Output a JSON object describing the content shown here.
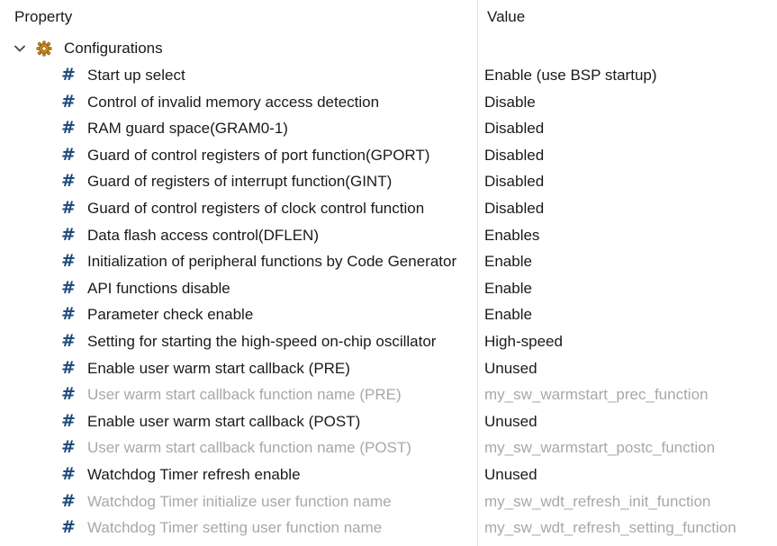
{
  "header": {
    "property_label": "Property",
    "value_label": "Value"
  },
  "group": {
    "label": "Configurations",
    "icon": "gear-icon",
    "expanded": true
  },
  "colors": {
    "hash_icon": "#1f4b7e",
    "disabled_text": "#a8a8a8"
  },
  "rows": [
    {
      "property": "Start up select",
      "value": "Enable (use BSP startup)",
      "enabled": true
    },
    {
      "property": "Control of invalid memory access detection",
      "value": "Disable",
      "enabled": true
    },
    {
      "property": "RAM guard space(GRAM0-1)",
      "value": "Disabled",
      "enabled": true
    },
    {
      "property": "Guard of control registers of port function(GPORT)",
      "value": "Disabled",
      "enabled": true
    },
    {
      "property": "Guard of registers of interrupt function(GINT)",
      "value": "Disabled",
      "enabled": true
    },
    {
      "property": "Guard of control registers of clock control function",
      "value": "Disabled",
      "enabled": true
    },
    {
      "property": "Data flash access control(DFLEN)",
      "value": "Enables",
      "enabled": true
    },
    {
      "property": "Initialization of peripheral functions by Code Generator",
      "value": "Enable",
      "enabled": true
    },
    {
      "property": "API functions disable",
      "value": "Enable",
      "enabled": true
    },
    {
      "property": "Parameter check enable",
      "value": "Enable",
      "enabled": true
    },
    {
      "property": "Setting for starting the high-speed on-chip oscillator",
      "value": "High-speed",
      "enabled": true
    },
    {
      "property": "Enable user warm start callback (PRE)",
      "value": "Unused",
      "enabled": true
    },
    {
      "property": "User warm start callback  function name (PRE)",
      "value": "my_sw_warmstart_prec_function",
      "enabled": false
    },
    {
      "property": "Enable user warm start callback (POST)",
      "value": "Unused",
      "enabled": true
    },
    {
      "property": "User warm start callback  function name (POST)",
      "value": "my_sw_warmstart_postc_function",
      "enabled": false
    },
    {
      "property": "Watchdog Timer refresh enable",
      "value": "Unused",
      "enabled": true
    },
    {
      "property": "Watchdog Timer initialize user function name",
      "value": "my_sw_wdt_refresh_init_function",
      "enabled": false
    },
    {
      "property": "Watchdog Timer setting user function name",
      "value": "my_sw_wdt_refresh_setting_function",
      "enabled": false
    }
  ]
}
